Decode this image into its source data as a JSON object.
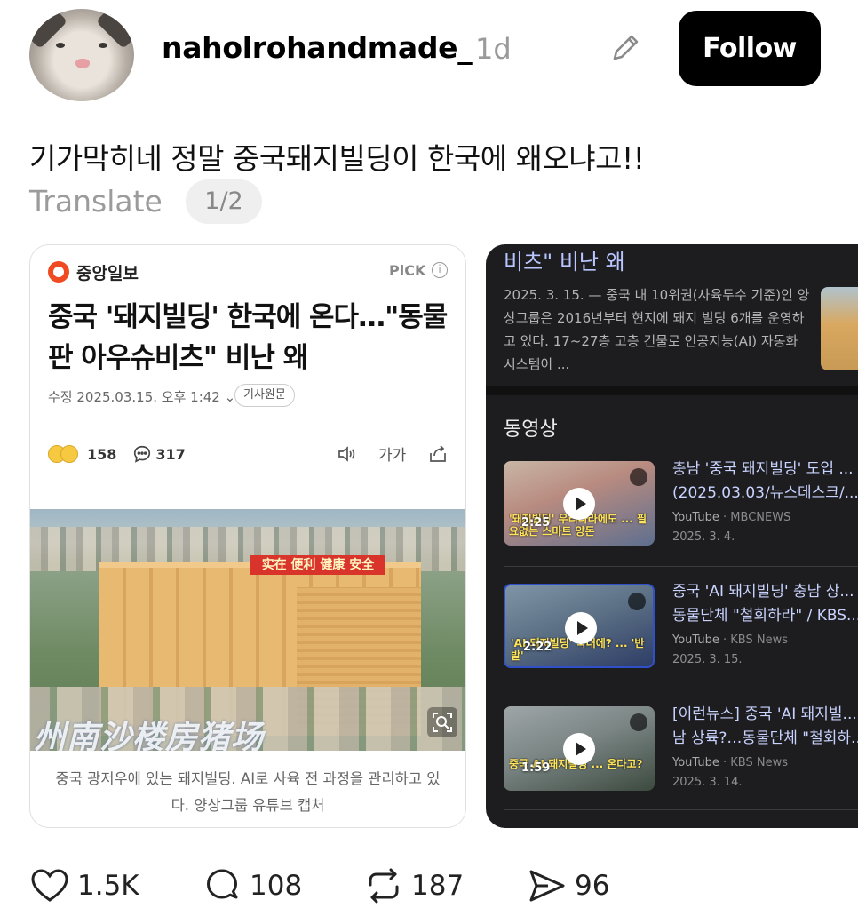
{
  "post": {
    "username": "naholrohandmade_",
    "time": "1d",
    "follow_label": "Follow",
    "caption": "기가막히네 정말 중국돼지빌딩이 한국에 왜오냐고!!",
    "translate_label": "Translate",
    "page_indicator": "1/2"
  },
  "article": {
    "publisher": "중앙일보",
    "pick_label": "PiCK",
    "headline": "중국 '돼지빌딩' 한국에 온다…\"동물판 아우슈비츠\" 비난 왜",
    "meta": "수정 2025.03.15. 오후 1:42",
    "original_label": "기사원문",
    "reactions_count": "158",
    "comments_count": "317",
    "font_label": "가가",
    "photo_sign": "实在 便利 健康 安全",
    "photo_watermark": "州南沙楼房猪场",
    "photo_caption": "중국 광저우에 있는 돼지빌딩. AI로 사육 전 과정을 관리하고 있다. 양상그룹 유튜브 캡처"
  },
  "search_panel": {
    "top_title": "비츠\" 비난 왜",
    "top_snippet": "2025. 3. 15. — 중국 내 10위권(사육두수 기준)인 양상그룹은 2016년부터 현지에 돼지 빌딩 6개를 운영하고 있다. 17~27층 고층 건물로 인공지능(AI) 자동화 시스템이 ...",
    "video_heading": "동영상",
    "videos": [
      {
        "title_line1": "충남 '중국 돼지빌딩' 도입 ...",
        "title_line2": "(2025.03.03/뉴스데스크/...",
        "source": "YouTube",
        "channel": "MBCNEWS",
        "date": "2025. 3. 4.",
        "duration": "2:25",
        "overlay": "'돼지빌딩' 우리나라에도 ... 필요없는 스마트 양돈"
      },
      {
        "title_line1": "중국 'AI 돼지빌딩' 충남 상...",
        "title_line2": "동물단체 \"철회하라\" / KBS...",
        "source": "YouTube",
        "channel": "KBS News",
        "date": "2025. 3. 15.",
        "duration": "2:22",
        "overlay": "'AI 돼지빌딩' 국내에? ... '반발'"
      },
      {
        "title_line1": "[이런뉴스] 중국 'AI 돼지빌...",
        "title_line2": "남 상륙?…동물단체 \"철회하...",
        "source": "YouTube",
        "channel": "KBS News",
        "date": "2025. 3. 14.",
        "duration": "1:59",
        "overlay": "중국 AI 돼지빌딩 ... 온다고?"
      }
    ]
  },
  "actions": {
    "likes": "1.5K",
    "replies": "108",
    "reposts": "187",
    "shares": "96"
  },
  "colors": {
    "follow_bg": "#000000",
    "muted_text": "#9a9a9a",
    "dark_panel": "#1d1d1f",
    "link_blue": "#c9d3ff",
    "publisher_red": "#f04a23"
  },
  "icons": [
    "edit-icon",
    "info-icon",
    "comment-icon",
    "speaker-icon",
    "share-icon",
    "zoom-icon",
    "play-icon",
    "heart-icon",
    "reply-icon",
    "repost-icon",
    "send-icon"
  ]
}
